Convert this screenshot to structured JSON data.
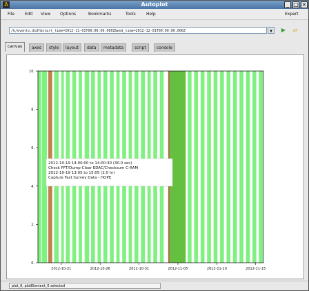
{
  "window": {
    "title": "Autoplot"
  },
  "menubar": {
    "items": [
      "File",
      "Edit",
      "View",
      "Options",
      "Bookmarks",
      "Tools",
      "Help"
    ],
    "expert": "Expert"
  },
  "url": {
    "value": "/k/events.dsdf&start_time=2012-11-01T00:00:00.000Z&end_time=2012-12-01T00:00:00.000Z"
  },
  "tabs": [
    "canvas",
    "axes",
    "style",
    "layout",
    "data",
    "metadata",
    "script",
    "console"
  ],
  "active_tab": "canvas",
  "plot": {
    "annotation": [
      "2012-10-19 14:00:00 to 14:00:30 (30.0 sec)",
      "Check FFT/Dump-Clear EDAC/Checksum C-RAM",
      "2012-10-19 13:05 to 15:05 (2.0 hr)",
      "Capture Fast Survey Data - HOPE"
    ]
  },
  "status": "plot_0, plotElement_0 selected",
  "colors": {
    "green": "#80f080",
    "dark_green": "#66c040",
    "brown": "#c08050",
    "dark_brown": "#9a7a40"
  },
  "chart_data": {
    "type": "event-timeline",
    "x_tick_labels": [
      "2012-10-21",
      "2012-10-26",
      "2012-10-31",
      "2012-11-05",
      "2012-11-10",
      "2012-11-15"
    ],
    "y_tick_labels": [
      "0",
      "2",
      "4",
      "6",
      "8",
      "10"
    ],
    "ylim": [
      0,
      10
    ],
    "xlim": [
      "2012-10-18",
      "2012-11-16"
    ],
    "events": [
      {
        "start": "2012-10-18T00:00",
        "end": "2012-10-18T10:00",
        "kind": "green"
      },
      {
        "start": "2012-10-18T12:00",
        "end": "2012-10-19T04:00",
        "kind": "green"
      },
      {
        "start": "2012-10-19T08:00",
        "end": "2012-10-19T20:00",
        "kind": "brown"
      },
      {
        "start": "2012-10-20T02:00",
        "end": "2012-10-20T16:00",
        "kind": "green"
      },
      {
        "start": "2012-10-21T00:00",
        "end": "2012-10-21T08:00",
        "kind": "green"
      },
      {
        "start": "2012-10-21T14:00",
        "end": "2012-10-22T02:00",
        "kind": "green"
      },
      {
        "start": "2012-10-22T10:00",
        "end": "2012-10-22T22:00",
        "kind": "green"
      },
      {
        "start": "2012-10-23T06:00",
        "end": "2012-10-23T16:00",
        "kind": "green"
      },
      {
        "start": "2012-10-24T00:00",
        "end": "2012-10-24T14:00",
        "kind": "green"
      },
      {
        "start": "2012-10-24T20:00",
        "end": "2012-10-25T08:00",
        "kind": "green"
      },
      {
        "start": "2012-10-25T16:00",
        "end": "2012-10-26T02:00",
        "kind": "green"
      },
      {
        "start": "2012-10-26T10:00",
        "end": "2012-10-26T22:00",
        "kind": "green"
      },
      {
        "start": "2012-10-27T06:00",
        "end": "2012-10-27T18:00",
        "kind": "green"
      },
      {
        "start": "2012-10-28T02:00",
        "end": "2012-10-28T12:00",
        "kind": "green"
      },
      {
        "start": "2012-10-28T20:00",
        "end": "2012-10-29T08:00",
        "kind": "green"
      },
      {
        "start": "2012-10-29T16:00",
        "end": "2012-10-30T02:00",
        "kind": "green"
      },
      {
        "start": "2012-10-30T10:00",
        "end": "2012-10-30T22:00",
        "kind": "green"
      },
      {
        "start": "2012-10-31T06:00",
        "end": "2012-10-31T18:00",
        "kind": "green"
      },
      {
        "start": "2012-11-01T02:00",
        "end": "2012-11-01T12:00",
        "kind": "green"
      },
      {
        "start": "2012-11-01T20:00",
        "end": "2012-11-02T08:00",
        "kind": "green"
      },
      {
        "start": "2012-11-02T16:00",
        "end": "2012-11-03T04:00",
        "kind": "green"
      },
      {
        "start": "2012-11-03T18:00",
        "end": "2012-11-04T00:00",
        "kind": "dark_brown"
      },
      {
        "start": "2012-11-04T00:00",
        "end": "2012-11-06T00:00",
        "kind": "dark_green"
      },
      {
        "start": "2012-11-06T06:00",
        "end": "2012-11-06T18:00",
        "kind": "green"
      },
      {
        "start": "2012-11-07T02:00",
        "end": "2012-11-07T14:00",
        "kind": "green"
      },
      {
        "start": "2012-11-07T22:00",
        "end": "2012-11-08T10:00",
        "kind": "green"
      },
      {
        "start": "2012-11-08T18:00",
        "end": "2012-11-09T06:00",
        "kind": "green"
      },
      {
        "start": "2012-11-09T14:00",
        "end": "2012-11-10T02:00",
        "kind": "green"
      },
      {
        "start": "2012-11-10T10:00",
        "end": "2012-11-10T22:00",
        "kind": "green"
      },
      {
        "start": "2012-11-11T06:00",
        "end": "2012-11-11T18:00",
        "kind": "green"
      },
      {
        "start": "2012-11-12T02:00",
        "end": "2012-11-12T14:00",
        "kind": "green"
      },
      {
        "start": "2012-11-12T22:00",
        "end": "2012-11-13T10:00",
        "kind": "green"
      },
      {
        "start": "2012-11-13T18:00",
        "end": "2012-11-14T06:00",
        "kind": "green"
      },
      {
        "start": "2012-11-14T14:00",
        "end": "2012-11-15T02:00",
        "kind": "green"
      },
      {
        "start": "2012-11-15T10:00",
        "end": "2012-11-15T22:00",
        "kind": "green"
      }
    ]
  }
}
